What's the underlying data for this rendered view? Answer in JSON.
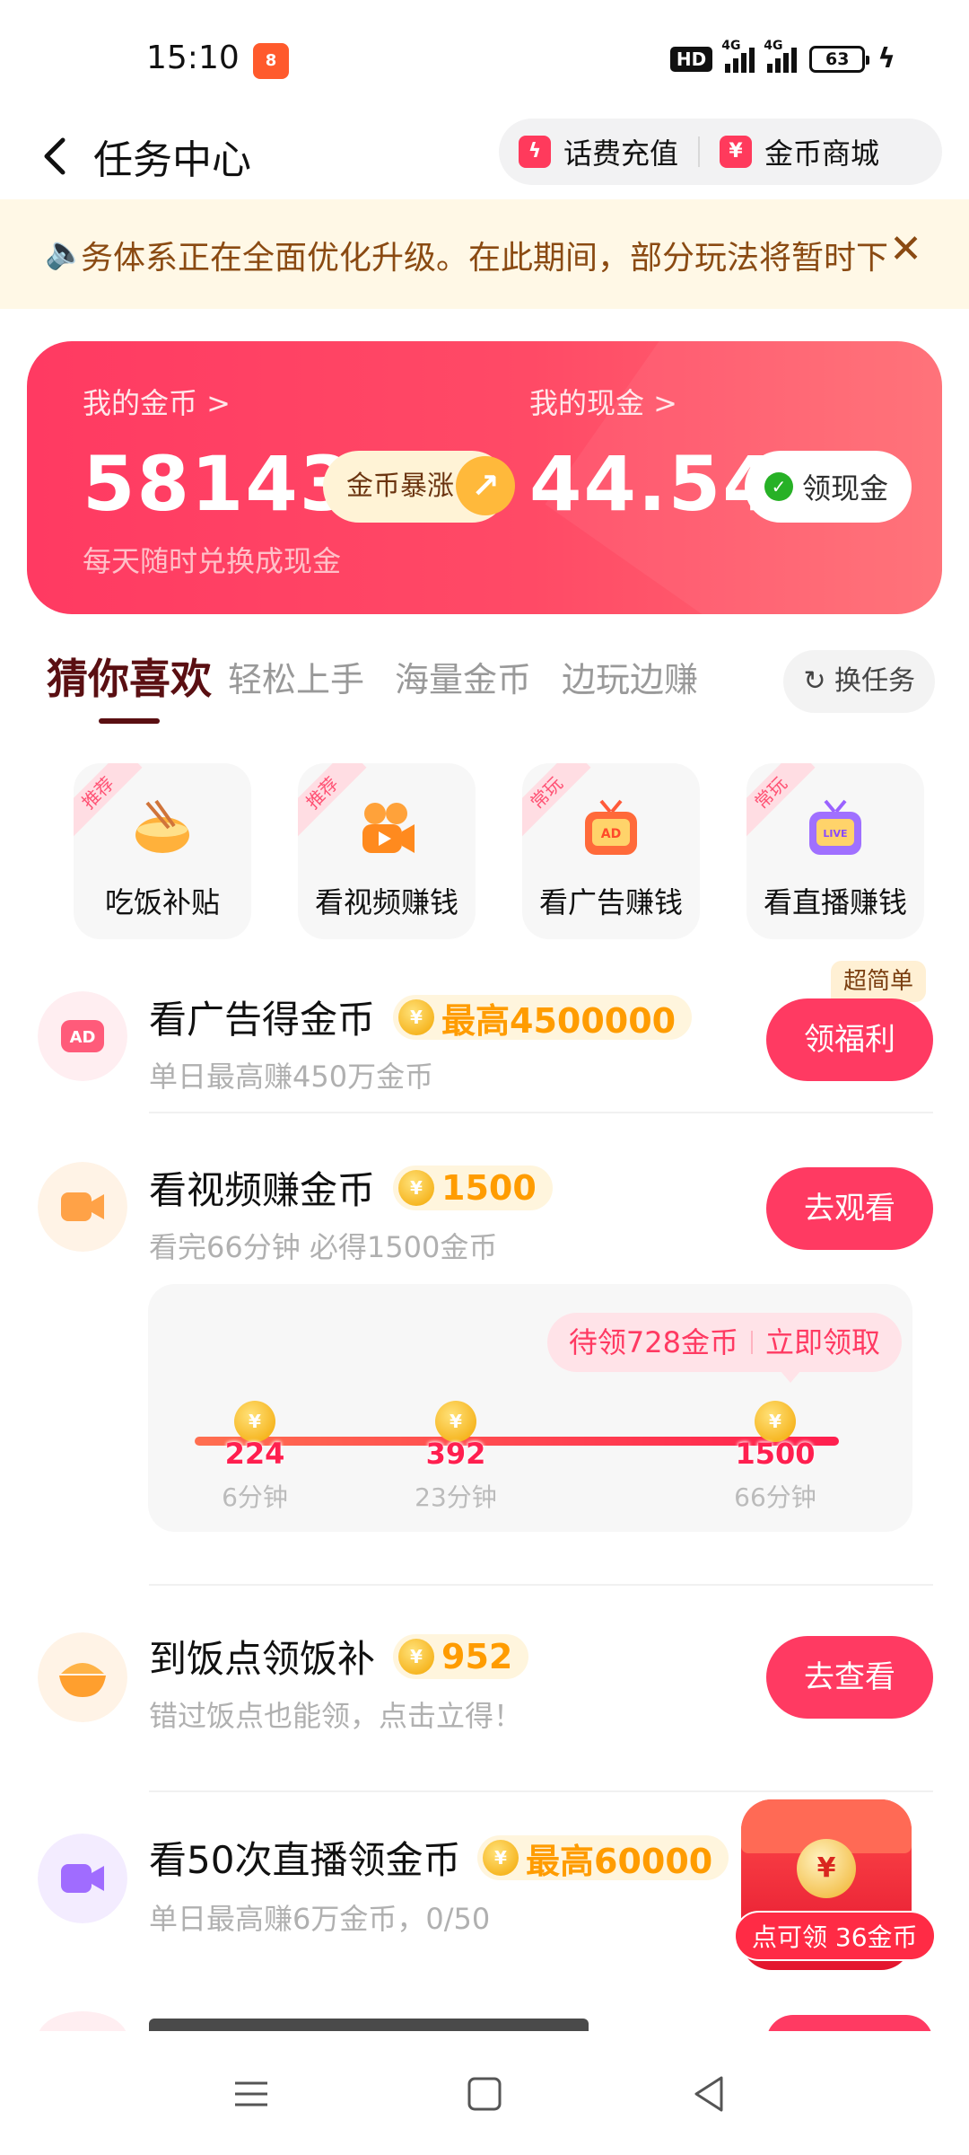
{
  "status_bar": {
    "time": "15:10",
    "hd_label": "HD",
    "net1": "4G",
    "net2": "4G",
    "battery": "63"
  },
  "header": {
    "title": "任务中心",
    "phone_recharge": "话费充值",
    "coin_mall": "金币商城"
  },
  "notice": {
    "text": "务体系正在全面优化升级。在此期间，部分玩法将暂时下线"
  },
  "wallet": {
    "coins_label": "我的金币 >",
    "coins_value": "58143",
    "coins_sub": "每天随时兑换成现金",
    "boom_label": "金币暴涨",
    "cash_label": "我的现金 >",
    "cash_value": "44.54",
    "cash_button": "领现金"
  },
  "tabs": {
    "items": [
      "猜你喜欢",
      "轻松上手",
      "海量金币",
      "边玩边赚"
    ],
    "swap": "换任务"
  },
  "categories": [
    {
      "tag": "推荐",
      "label": "吃饭补贴"
    },
    {
      "tag": "推荐",
      "label": "看视频赚钱"
    },
    {
      "tag": "常玩",
      "label": "看广告赚钱"
    },
    {
      "tag": "常玩",
      "label": "看直播赚钱"
    }
  ],
  "tasks": [
    {
      "title": "看广告得金币",
      "badge": "最高4500000",
      "sub": "单日最高赚450万金币",
      "button": "领福利",
      "hint": "超简单"
    },
    {
      "title": "看视频赚金币",
      "badge": "1500",
      "sub": "看完66分钟 必得1500金币",
      "button": "去观看"
    },
    {
      "title": "到饭点领饭补",
      "badge": "952",
      "sub": "错过饭点也能领，点击立得！",
      "button": "去查看"
    },
    {
      "title": "看50次直播领金币",
      "badge": "最高60000",
      "sub": "单日最高赚6万金币，0/50"
    }
  ],
  "video_progress": {
    "pending": "待领728金币",
    "claim": "立即领取",
    "milestones": [
      {
        "value": "224",
        "time": "6分钟"
      },
      {
        "value": "392",
        "time": "23分钟"
      },
      {
        "value": "1500",
        "time": "66分钟"
      }
    ]
  },
  "floating_chest": {
    "label": "点可领 36金币"
  },
  "colors": {
    "accent": "#ff3a62",
    "coin": "#ff9c00",
    "notice_bg": "#fff8e6",
    "notice_text": "#8a4a12"
  }
}
